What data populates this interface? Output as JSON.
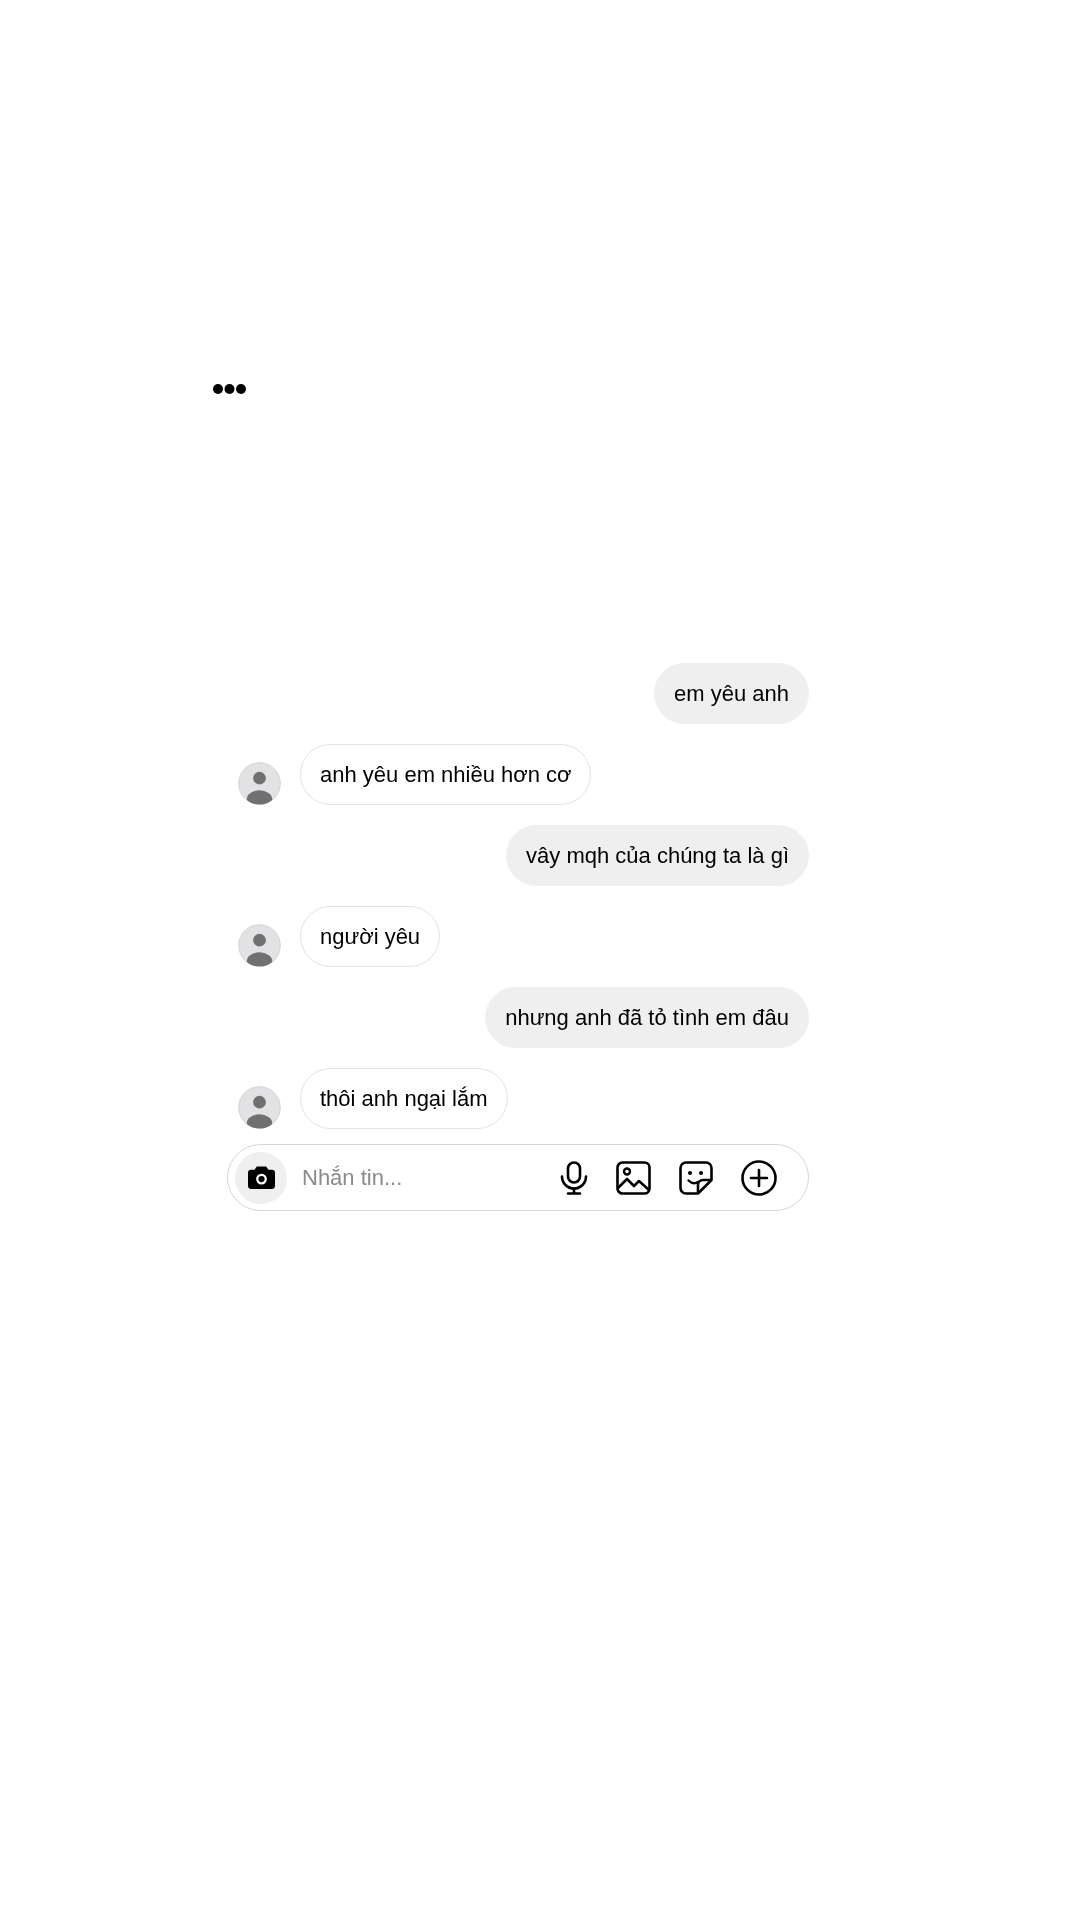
{
  "messages": [
    {
      "kind": "sent",
      "text": "em yêu anh"
    },
    {
      "kind": "received",
      "text": "anh yêu em nhiều hơn cơ"
    },
    {
      "kind": "sent",
      "text": "vây mqh của chúng ta là gì"
    },
    {
      "kind": "received",
      "text": "người yêu"
    },
    {
      "kind": "sent",
      "text": "nhưng anh đã tỏ tình em đâu"
    },
    {
      "kind": "received",
      "text": "thôi anh ngại lắm"
    }
  ],
  "composer": {
    "placeholder": "Nhắn tin..."
  }
}
